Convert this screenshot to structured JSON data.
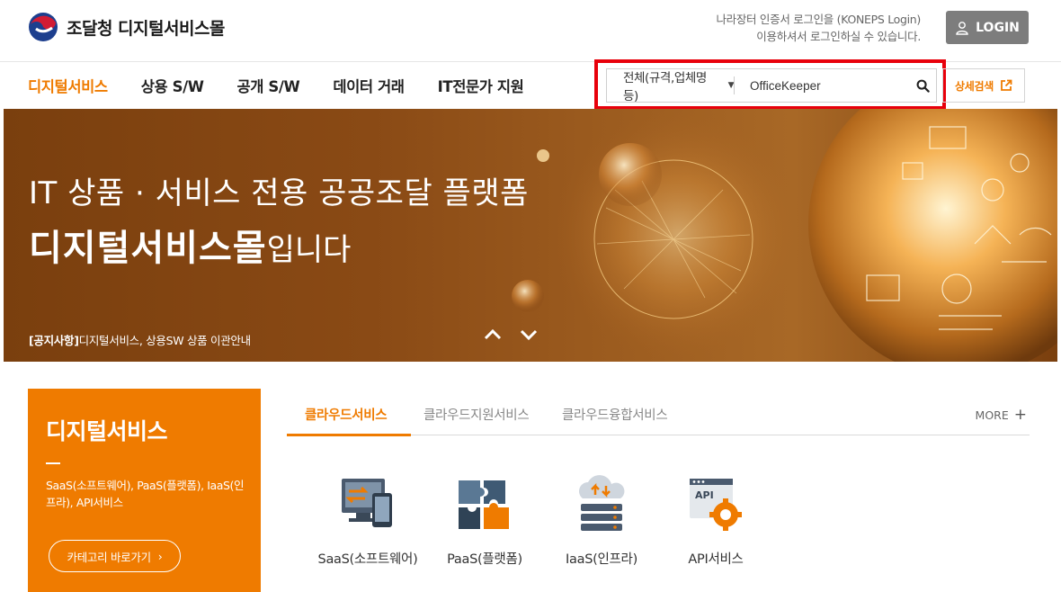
{
  "header": {
    "logo_text": "조달청 디지털서비스몰",
    "login_note_line1": "나라장터 인증서 로그인을 (KONEPS Login)",
    "login_note_line2": "이용하셔서 로그인하실 수 있습니다.",
    "login_label": "LOGIN"
  },
  "nav": {
    "items": [
      {
        "label": "디지털서비스",
        "active": true
      },
      {
        "label": "상용 S/W",
        "active": false
      },
      {
        "label": "공개 S/W",
        "active": false
      },
      {
        "label": "데이터 거래",
        "active": false
      },
      {
        "label": "IT전문가 지원",
        "active": false
      }
    ]
  },
  "search": {
    "category": "전체(규격,업체명 등)",
    "value": "OfficeKeeper",
    "advanced_label": "상세검색"
  },
  "hero": {
    "line1": "IT 상품 · 서비스 전용 공공조달 플랫폼",
    "line2_strong": "디지털서비스몰",
    "line2_light": "입니다",
    "notice_tag": "[공지사항]",
    "notice_text": "디지털서비스, 상용SW 상품 이관안내"
  },
  "side_card": {
    "title": "디지털서비스",
    "desc": "SaaS(소프트웨어), PaaS(플랫폼), IaaS(인프라), API서비스",
    "button_label": "카테고리 바로가기"
  },
  "tabs": {
    "items": [
      {
        "label": "클라우드서비스",
        "active": true
      },
      {
        "label": "클라우드지원서비스",
        "active": false
      },
      {
        "label": "클라우드융합서비스",
        "active": false
      }
    ],
    "more_label": "MORE"
  },
  "services": [
    {
      "label": "SaaS(소프트웨어)",
      "icon": "saas-icon"
    },
    {
      "label": "PaaS(플랫폼)",
      "icon": "paas-icon"
    },
    {
      "label": "IaaS(인프라)",
      "icon": "iaas-icon"
    },
    {
      "label": "API서비스",
      "icon": "api-icon"
    }
  ],
  "colors": {
    "accent": "#ef7b00",
    "highlight": "#e8000b",
    "login_bg": "#7d7d7d"
  }
}
